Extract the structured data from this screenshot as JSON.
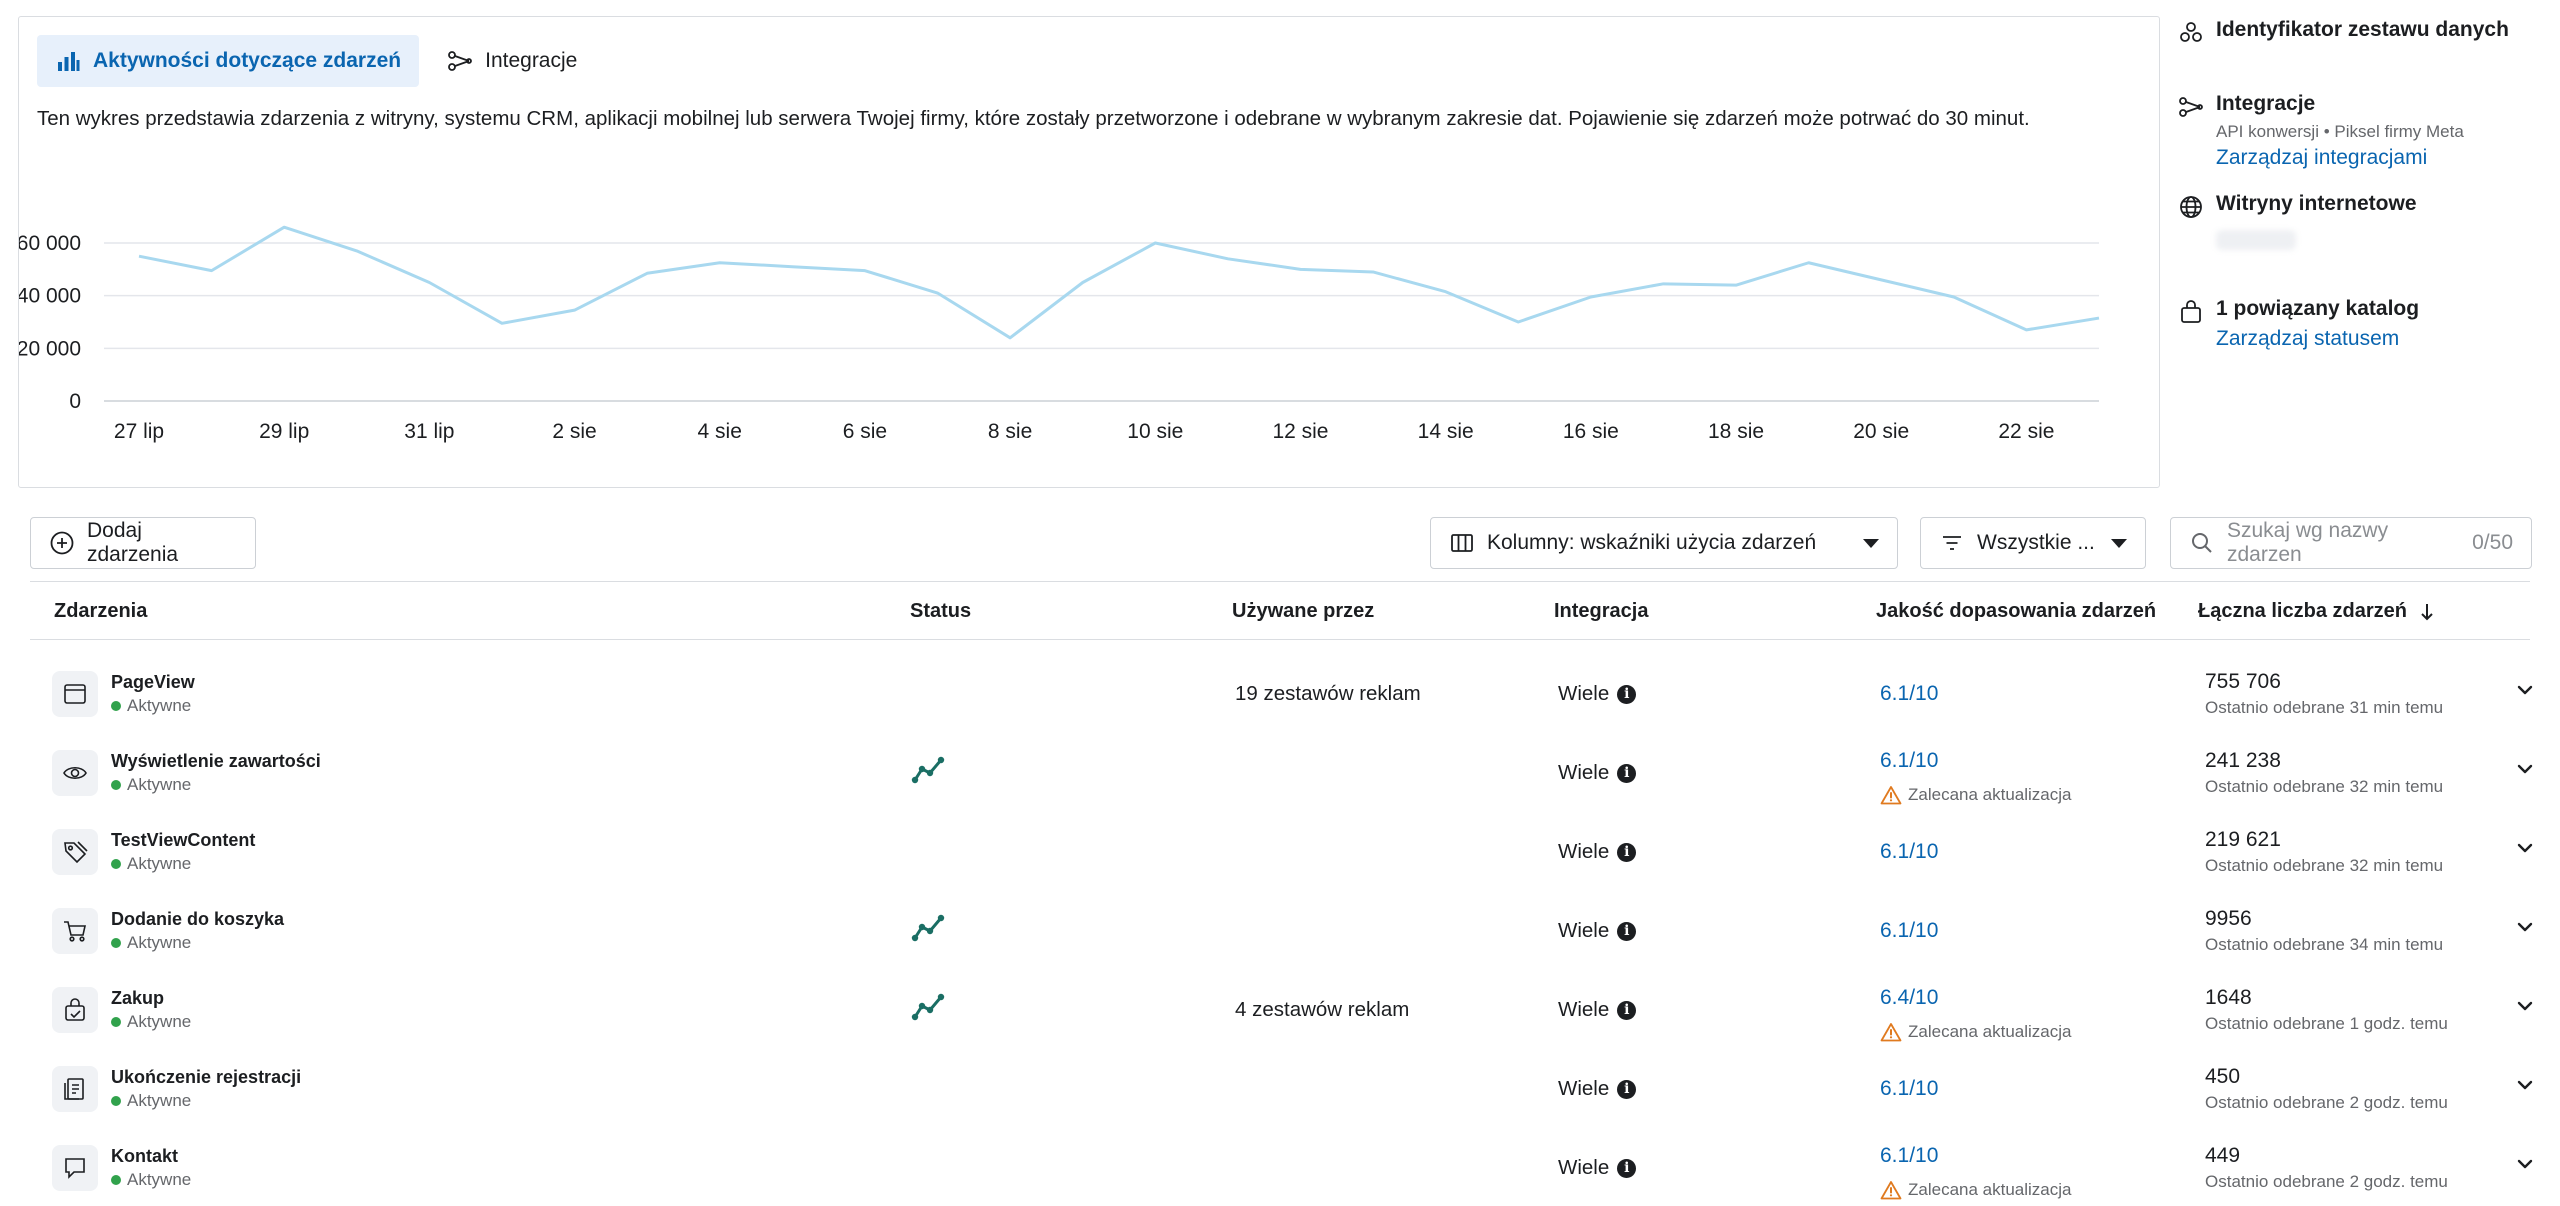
{
  "tabs": {
    "activity": "Aktywności dotyczące zdarzeń",
    "integrations": "Integracje"
  },
  "description": "Ten wykres przedstawia zdarzenia z witryny, systemu CRM, aplikacji mobilnej lub serwera Twojej firmy, które zostały przetworzone i odebrane w wybranym zakresie dat. Pojawienie się zdarzeń może potrwać do 30 minut.",
  "chart_data": {
    "type": "line",
    "title": "",
    "xlabel": "",
    "ylabel": "",
    "ylim": [
      0,
      60000
    ],
    "y_ticks": [
      "0",
      "20 000",
      "40 000",
      "60 000"
    ],
    "y_tick_values": [
      0,
      20000,
      40000,
      60000
    ],
    "x_tick_labels": [
      "27 lip",
      "29 lip",
      "31 lip",
      "2 sie",
      "4 sie",
      "6 sie",
      "8 sie",
      "10 sie",
      "12 sie",
      "14 sie",
      "16 sie",
      "18 sie",
      "20 sie",
      "22 sie"
    ],
    "x": [
      "27 lip",
      "28 lip",
      "29 lip",
      "30 lip",
      "31 lip",
      "1 sie",
      "2 sie",
      "3 sie",
      "4 sie",
      "5 sie",
      "6 sie",
      "7 sie",
      "8 sie",
      "9 sie",
      "10 sie",
      "11 sie",
      "12 sie",
      "13 sie",
      "14 sie",
      "15 sie",
      "16 sie",
      "17 sie",
      "18 sie",
      "19 sie",
      "20 sie",
      "21 sie",
      "22 sie",
      "23 sie"
    ],
    "series": [
      {
        "values": [
          55000,
          49500,
          66000,
          57000,
          45000,
          29500,
          34500,
          48500,
          52500,
          51000,
          49500,
          41000,
          24000,
          45000,
          60000,
          54000,
          50000,
          49000,
          41500,
          30000,
          39500,
          44500,
          44000,
          52500,
          46000,
          39500,
          27000,
          31500
        ]
      }
    ],
    "grid": true,
    "line_color": "#a8d8ef"
  },
  "side": {
    "dataset_id": "Identyfikator zestawu danych",
    "integrations_title": "Integracje",
    "integrations_sub": "API konwersji • Piksel firmy Meta",
    "manage_integrations": "Zarządzaj integracjami",
    "websites_title": "Witryny internetowe",
    "catalog_title": "1 powiązany katalog",
    "manage_status": "Zarządzaj statusem"
  },
  "toolbar": {
    "add_events": "Dodaj zdarzenia",
    "columns_select": "Kolumny: wskaźniki użycia zdarzeń",
    "filter_select": "Wszystkie ...",
    "search_placeholder": "Szukaj wg nazwy zdarzen",
    "search_count": "0/50"
  },
  "table": {
    "headers": {
      "events": "Zdarzenia",
      "status": "Status",
      "used_by": "Używane przez",
      "integration": "Integracja",
      "match_quality": "Jakość dopasowania zdarzeń",
      "total": "Łączna liczba zdarzeń"
    },
    "rows": [
      {
        "icon": "browser-window-icon",
        "name": "PageView",
        "status": "Aktywne",
        "trend": false,
        "used_by": "19 zestawów reklam",
        "integration": "Wiele",
        "score": "6.1/10",
        "warning": "",
        "total": "755 706",
        "last": "Ostatnio odebrane 31 min temu"
      },
      {
        "icon": "eye-icon",
        "name": "Wyświetlenie zawartości",
        "status": "Aktywne",
        "trend": true,
        "used_by": "",
        "integration": "Wiele",
        "score": "6.1/10",
        "warning": "Zalecana aktualizacja",
        "total": "241 238",
        "last": "Ostatnio odebrane 32 min temu"
      },
      {
        "icon": "tag-icon",
        "name": "TestViewContent",
        "status": "Aktywne",
        "trend": false,
        "used_by": "",
        "integration": "Wiele",
        "score": "6.1/10",
        "warning": "",
        "total": "219 621",
        "last": "Ostatnio odebrane 32 min temu"
      },
      {
        "icon": "cart-icon",
        "name": "Dodanie do koszyka",
        "status": "Aktywne",
        "trend": true,
        "used_by": "",
        "integration": "Wiele",
        "score": "6.1/10",
        "warning": "",
        "total": "9956",
        "last": "Ostatnio odebrane 34 min temu"
      },
      {
        "icon": "shopping-bag-icon",
        "name": "Zakup",
        "status": "Aktywne",
        "trend": true,
        "used_by": "4 zestawów reklam",
        "integration": "Wiele",
        "score": "6.4/10",
        "warning": "Zalecana aktualizacja",
        "total": "1648",
        "last": "Ostatnio odebrane 1 godz. temu"
      },
      {
        "icon": "registration-icon",
        "name": "Ukończenie rejestracji",
        "status": "Aktywne",
        "trend": false,
        "used_by": "",
        "integration": "Wiele",
        "score": "6.1/10",
        "warning": "",
        "total": "450",
        "last": "Ostatnio odebrane 2 godz. temu"
      },
      {
        "icon": "chat-bubble-icon",
        "name": "Kontakt",
        "status": "Aktywne",
        "trend": false,
        "used_by": "",
        "integration": "Wiele",
        "score": "6.1/10",
        "warning": "Zalecana aktualizacja",
        "total": "449",
        "last": "Ostatnio odebrane 2 godz. temu"
      }
    ]
  }
}
